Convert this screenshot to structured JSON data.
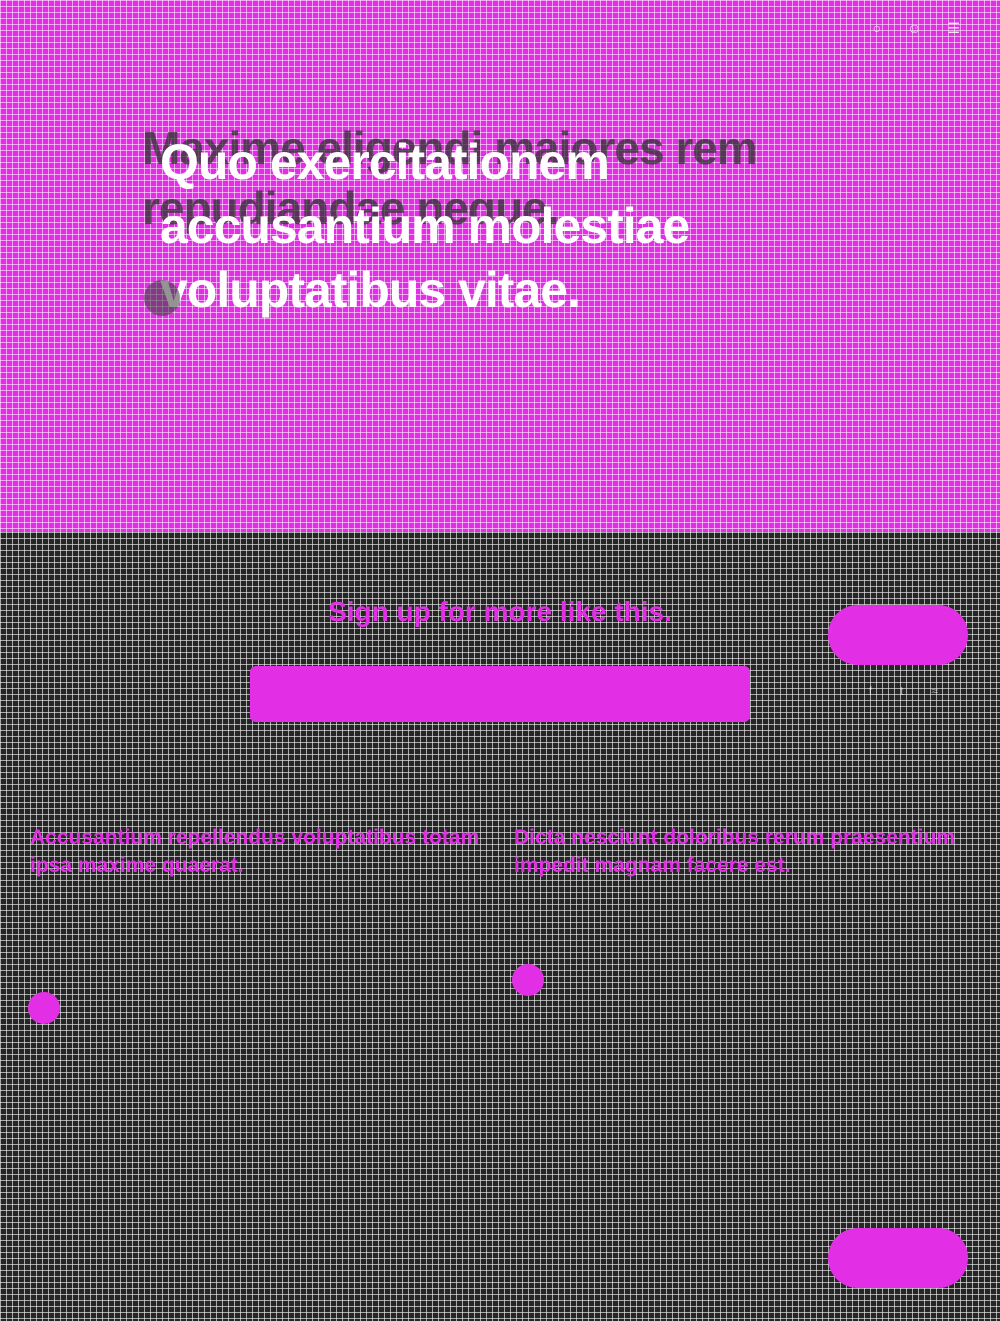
{
  "hero": {
    "title_back": "Maxime eligendi maiores rem repudiandae neque.",
    "title_front": "Quo exercitationem accusantium molestiae voluptatibus vitae.",
    "meta": "",
    "excerpt_back": "",
    "excerpt_front": ""
  },
  "signup": {
    "title": "Sign up for more like this.",
    "button_label": "",
    "email_placeholder": ""
  },
  "cards": [
    {
      "title": "Accusantium repellendus voluptatibus totam ipsa maxime quaerat.",
      "excerpt": "",
      "author": "",
      "date": ""
    },
    {
      "title": "Dicta nesciunt doloribus rerum praesentium impedit magnam facere est.",
      "excerpt": "",
      "author": "",
      "date": ""
    }
  ],
  "icons": {
    "top": [
      "search-icon",
      "account-icon",
      "menu-icon"
    ],
    "subnav": [
      "facebook-icon",
      "twitter-icon",
      "rss-icon"
    ]
  },
  "colors": {
    "accent": "#e22fe6",
    "dark_bg": "#262626",
    "text_light": "#ffffff"
  }
}
